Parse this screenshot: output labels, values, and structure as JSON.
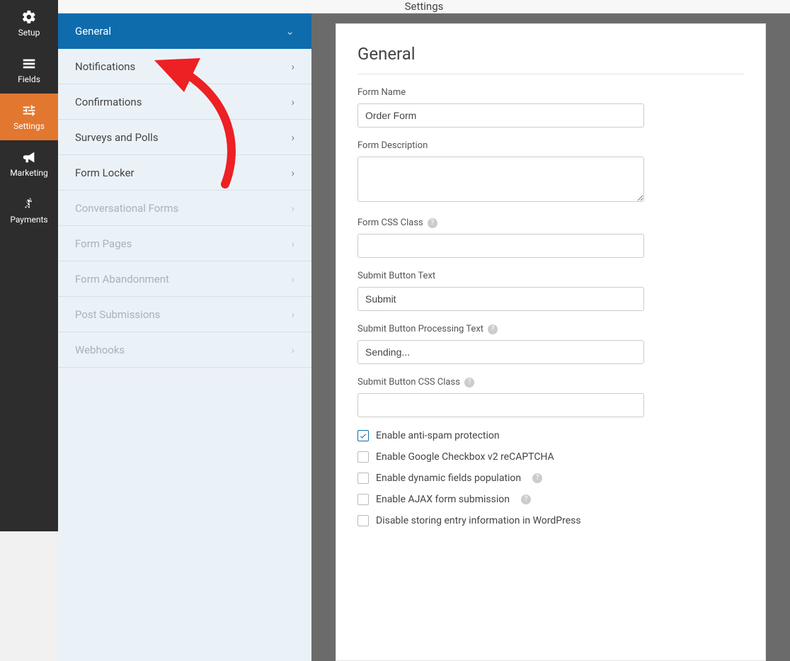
{
  "topbar": {
    "title": "Settings"
  },
  "iconbar": {
    "items": [
      {
        "label": "Setup"
      },
      {
        "label": "Fields"
      },
      {
        "label": "Settings"
      },
      {
        "label": "Marketing"
      },
      {
        "label": "Payments"
      }
    ]
  },
  "settings_sidebar": {
    "items": [
      {
        "label": "General",
        "active": true,
        "muted": false
      },
      {
        "label": "Notifications",
        "active": false,
        "muted": false
      },
      {
        "label": "Confirmations",
        "active": false,
        "muted": false
      },
      {
        "label": "Surveys and Polls",
        "active": false,
        "muted": false
      },
      {
        "label": "Form Locker",
        "active": false,
        "muted": false
      },
      {
        "label": "Conversational Forms",
        "active": false,
        "muted": true
      },
      {
        "label": "Form Pages",
        "active": false,
        "muted": true
      },
      {
        "label": "Form Abandonment",
        "active": false,
        "muted": true
      },
      {
        "label": "Post Submissions",
        "active": false,
        "muted": true
      },
      {
        "label": "Webhooks",
        "active": false,
        "muted": true
      }
    ]
  },
  "panel": {
    "heading": "General",
    "fields": {
      "form_name": {
        "label": "Form Name",
        "value": "Order Form"
      },
      "form_description": {
        "label": "Form Description",
        "value": ""
      },
      "form_css_class": {
        "label": "Form CSS Class",
        "value": ""
      },
      "submit_button_text": {
        "label": "Submit Button Text",
        "value": "Submit"
      },
      "submit_button_processing_text": {
        "label": "Submit Button Processing Text",
        "value": "Sending..."
      },
      "submit_button_css_class": {
        "label": "Submit Button CSS Class",
        "value": ""
      }
    },
    "checkboxes": [
      {
        "label": "Enable anti-spam protection",
        "checked": true,
        "help": false
      },
      {
        "label": "Enable Google Checkbox v2 reCAPTCHA",
        "checked": false,
        "help": false
      },
      {
        "label": "Enable dynamic fields population",
        "checked": false,
        "help": true
      },
      {
        "label": "Enable AJAX form submission",
        "checked": false,
        "help": true
      },
      {
        "label": "Disable storing entry information in WordPress",
        "checked": false,
        "help": false
      }
    ]
  },
  "colors": {
    "accent": "#e27730",
    "primary": "#0e6cad",
    "annotation": "#ed2024"
  }
}
